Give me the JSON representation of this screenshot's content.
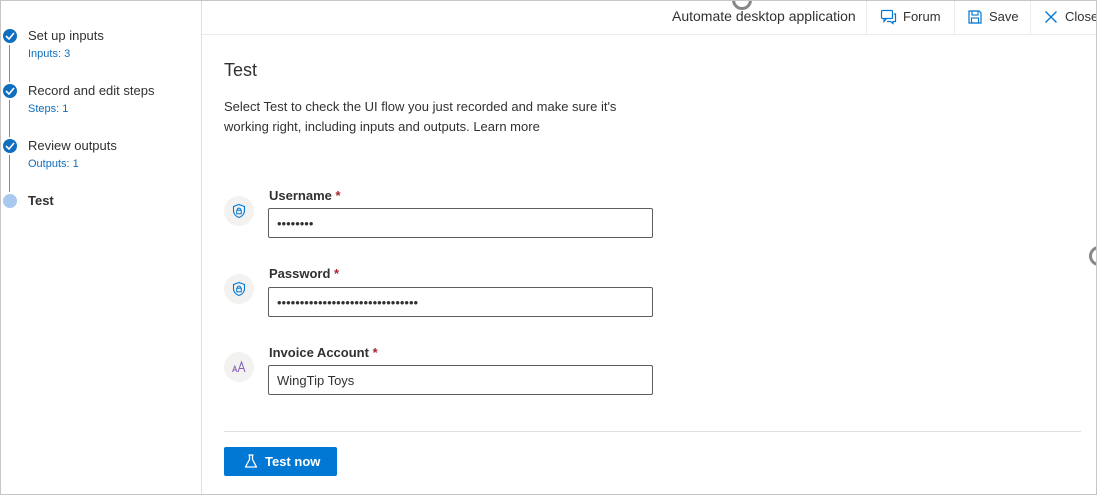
{
  "sidebar": {
    "steps": [
      {
        "label": "Set up inputs",
        "sub": "Inputs: 3",
        "state": "done"
      },
      {
        "label": "Record and edit steps",
        "sub": "Steps: 1",
        "state": "done"
      },
      {
        "label": "Review outputs",
        "sub": "Outputs: 1",
        "state": "done"
      },
      {
        "label": "Test",
        "sub": "",
        "state": "current"
      }
    ]
  },
  "header": {
    "title": "Automate desktop application",
    "forum_label": "Forum",
    "save_label": "Save",
    "close_label": "Close",
    "icons": {
      "forum": "forum-icon",
      "save": "save-icon",
      "close": "close-icon"
    }
  },
  "main": {
    "title": "Test",
    "description": "Select Test to check the UI flow you just recorded and make sure it's working right, including inputs and outputs. Learn more",
    "fields": [
      {
        "label": "Username",
        "required_mark": "*",
        "value": "••••••••",
        "icon": "shield-lock-icon"
      },
      {
        "label": "Password",
        "required_mark": "*",
        "value": "•••••••••••••••••••••••••••••••",
        "icon": "shield-lock-icon"
      },
      {
        "label": "Invoice Account",
        "required_mark": "*",
        "value": "WingTip Toys",
        "icon": "text-type-icon"
      }
    ],
    "test_button_label": "Test now"
  },
  "colors": {
    "accent": "#0078d4",
    "step_done": "#106ebe",
    "step_current": "#a9c8f0",
    "required": "#a4262c"
  }
}
